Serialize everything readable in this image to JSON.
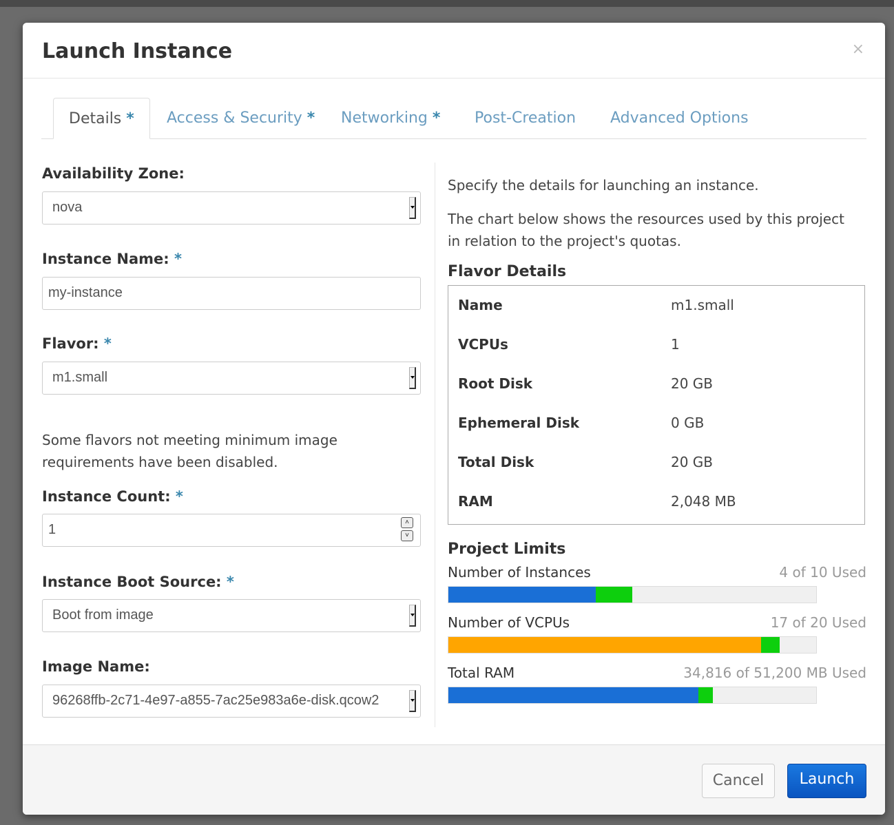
{
  "modal": {
    "title": "Launch Instance",
    "close_glyph": "×"
  },
  "tabs": [
    {
      "label": "Details",
      "required": "*"
    },
    {
      "label": "Access & Security",
      "required": "*"
    },
    {
      "label": "Networking",
      "required": "*"
    },
    {
      "label": "Post-Creation",
      "required": ""
    },
    {
      "label": "Advanced Options",
      "required": ""
    }
  ],
  "form": {
    "availability_zone": {
      "label": "Availability Zone:",
      "value": "nova"
    },
    "instance_name": {
      "label": "Instance Name:",
      "required": "*",
      "value": "my-instance"
    },
    "flavor": {
      "label": "Flavor:",
      "required": "*",
      "value": "m1.small"
    },
    "flavor_help": "Some flavors not meeting minimum image requirements have been disabled.",
    "instance_count": {
      "label": "Instance Count:",
      "required": "*",
      "value": "1"
    },
    "boot_source": {
      "label": "Instance Boot Source:",
      "required": "*",
      "value": "Boot from image"
    },
    "image_name": {
      "label": "Image Name:",
      "value": "96268ffb-2c71-4e97-a855-7ac25e983a6e-disk.qcow2"
    }
  },
  "info": {
    "intro": "Specify the details for launching an instance.",
    "chart_note": "The chart below shows the resources used by this project in relation to the project's quotas.",
    "flavor_heading": "Flavor Details",
    "flavor_rows": [
      {
        "key": "Name",
        "value": "m1.small"
      },
      {
        "key": "VCPUs",
        "value": "1"
      },
      {
        "key": "Root Disk",
        "value": "20 GB"
      },
      {
        "key": "Ephemeral Disk",
        "value": "0 GB"
      },
      {
        "key": "Total Disk",
        "value": "20 GB"
      },
      {
        "key": "RAM",
        "value": "2,048 MB"
      }
    ],
    "limits_heading": "Project Limits",
    "limits": [
      {
        "label": "Number of Instances",
        "used_text": "4 of 10 Used",
        "used_fraction": 0.4,
        "added_fraction": 0.1,
        "color": "#1a6fd6"
      },
      {
        "label": "Number of VCPUs",
        "used_text": "17 of 20 Used",
        "used_fraction": 0.85,
        "added_fraction": 0.05,
        "color": "#ffa500"
      },
      {
        "label": "Total RAM",
        "used_text": "34,816 of 51,200 MB Used",
        "used_fraction": 0.68,
        "added_fraction": 0.04,
        "color": "#1a6fd6"
      }
    ]
  },
  "footer": {
    "cancel_label": "Cancel",
    "launch_label": "Launch"
  }
}
